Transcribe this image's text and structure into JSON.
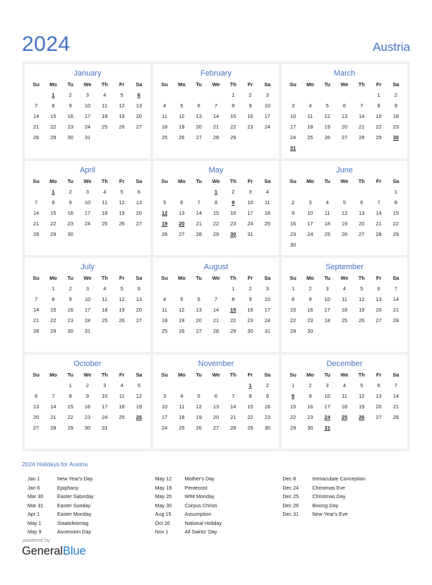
{
  "header": {
    "year": "2024",
    "country": "Austria",
    "accent_color": "#4472C4",
    "holiday_color": "#E00000"
  },
  "weekday_headers": [
    "Su",
    "Mo",
    "Tu",
    "We",
    "Th",
    "Fr",
    "Sa"
  ],
  "months": [
    {
      "name": "January",
      "weeks": [
        [
          "",
          "1",
          "2",
          "3",
          "4",
          "5",
          "6"
        ],
        [
          "7",
          "8",
          "9",
          "10",
          "11",
          "12",
          "13"
        ],
        [
          "14",
          "15",
          "16",
          "17",
          "18",
          "19",
          "20"
        ],
        [
          "21",
          "22",
          "23",
          "24",
          "25",
          "26",
          "27"
        ],
        [
          "28",
          "29",
          "30",
          "31",
          "",
          "",
          ""
        ],
        [
          "",
          "",
          "",
          "",
          "",
          "",
          ""
        ]
      ],
      "holidays": [
        "1",
        "6"
      ]
    },
    {
      "name": "February",
      "weeks": [
        [
          "",
          "",
          "",
          "",
          "1",
          "2",
          "3"
        ],
        [
          "4",
          "5",
          "6",
          "7",
          "8",
          "9",
          "10"
        ],
        [
          "11",
          "12",
          "13",
          "14",
          "15",
          "16",
          "17"
        ],
        [
          "18",
          "19",
          "20",
          "21",
          "22",
          "23",
          "24"
        ],
        [
          "25",
          "26",
          "27",
          "28",
          "29",
          "",
          ""
        ],
        [
          "",
          "",
          "",
          "",
          "",
          "",
          ""
        ]
      ],
      "holidays": []
    },
    {
      "name": "March",
      "weeks": [
        [
          "",
          "",
          "",
          "",
          "",
          "1",
          "2"
        ],
        [
          "3",
          "4",
          "5",
          "6",
          "7",
          "8",
          "9"
        ],
        [
          "10",
          "11",
          "12",
          "13",
          "14",
          "15",
          "16"
        ],
        [
          "17",
          "18",
          "19",
          "20",
          "21",
          "22",
          "23"
        ],
        [
          "24",
          "25",
          "26",
          "27",
          "28",
          "29",
          "30"
        ],
        [
          "31",
          "",
          "",
          "",
          "",
          "",
          ""
        ]
      ],
      "holidays": [
        "30",
        "31"
      ]
    },
    {
      "name": "April",
      "weeks": [
        [
          "",
          "1",
          "2",
          "3",
          "4",
          "5",
          "6"
        ],
        [
          "7",
          "8",
          "9",
          "10",
          "11",
          "12",
          "13"
        ],
        [
          "14",
          "15",
          "16",
          "17",
          "18",
          "19",
          "20"
        ],
        [
          "21",
          "22",
          "23",
          "24",
          "25",
          "26",
          "27"
        ],
        [
          "28",
          "29",
          "30",
          "",
          "",
          "",
          ""
        ],
        [
          "",
          "",
          "",
          "",
          "",
          "",
          ""
        ]
      ],
      "holidays": [
        "1"
      ]
    },
    {
      "name": "May",
      "weeks": [
        [
          "",
          "",
          "",
          "1",
          "2",
          "3",
          "4"
        ],
        [
          "5",
          "6",
          "7",
          "8",
          "9",
          "10",
          "11"
        ],
        [
          "12",
          "13",
          "14",
          "15",
          "16",
          "17",
          "18"
        ],
        [
          "19",
          "20",
          "21",
          "22",
          "23",
          "24",
          "25"
        ],
        [
          "26",
          "27",
          "28",
          "29",
          "30",
          "31",
          ""
        ],
        [
          "",
          "",
          "",
          "",
          "",
          "",
          ""
        ]
      ],
      "holidays": [
        "1",
        "9",
        "12",
        "19",
        "20",
        "30"
      ]
    },
    {
      "name": "June",
      "weeks": [
        [
          "",
          "",
          "",
          "",
          "",
          "",
          "1"
        ],
        [
          "2",
          "3",
          "4",
          "5",
          "6",
          "7",
          "8"
        ],
        [
          "9",
          "10",
          "11",
          "12",
          "13",
          "14",
          "15"
        ],
        [
          "16",
          "17",
          "18",
          "19",
          "20",
          "21",
          "22"
        ],
        [
          "23",
          "24",
          "25",
          "26",
          "27",
          "28",
          "29"
        ],
        [
          "30",
          "",
          "",
          "",
          "",
          "",
          ""
        ]
      ],
      "holidays": []
    },
    {
      "name": "July",
      "weeks": [
        [
          "",
          "1",
          "2",
          "3",
          "4",
          "5",
          "6"
        ],
        [
          "7",
          "8",
          "9",
          "10",
          "11",
          "12",
          "13"
        ],
        [
          "14",
          "15",
          "16",
          "17",
          "18",
          "19",
          "20"
        ],
        [
          "21",
          "22",
          "23",
          "24",
          "25",
          "26",
          "27"
        ],
        [
          "28",
          "29",
          "30",
          "31",
          "",
          "",
          ""
        ],
        [
          "",
          "",
          "",
          "",
          "",
          "",
          ""
        ]
      ],
      "holidays": []
    },
    {
      "name": "August",
      "weeks": [
        [
          "",
          "",
          "",
          "",
          "1",
          "2",
          "3"
        ],
        [
          "4",
          "5",
          "6",
          "7",
          "8",
          "9",
          "10"
        ],
        [
          "11",
          "12",
          "13",
          "14",
          "15",
          "16",
          "17"
        ],
        [
          "18",
          "19",
          "20",
          "21",
          "22",
          "23",
          "24"
        ],
        [
          "25",
          "26",
          "27",
          "28",
          "29",
          "30",
          "31"
        ],
        [
          "",
          "",
          "",
          "",
          "",
          "",
          ""
        ]
      ],
      "holidays": [
        "15"
      ]
    },
    {
      "name": "September",
      "weeks": [
        [
          "1",
          "2",
          "3",
          "4",
          "5",
          "6",
          "7"
        ],
        [
          "8",
          "9",
          "10",
          "11",
          "12",
          "13",
          "14"
        ],
        [
          "15",
          "16",
          "17",
          "18",
          "19",
          "20",
          "21"
        ],
        [
          "22",
          "23",
          "24",
          "25",
          "26",
          "27",
          "28"
        ],
        [
          "29",
          "30",
          "",
          "",
          "",
          "",
          ""
        ],
        [
          "",
          "",
          "",
          "",
          "",
          "",
          ""
        ]
      ],
      "holidays": []
    },
    {
      "name": "October",
      "weeks": [
        [
          "",
          "",
          "1",
          "2",
          "3",
          "4",
          "5"
        ],
        [
          "6",
          "7",
          "8",
          "9",
          "10",
          "11",
          "12"
        ],
        [
          "13",
          "14",
          "15",
          "16",
          "17",
          "18",
          "19"
        ],
        [
          "20",
          "21",
          "22",
          "23",
          "24",
          "25",
          "26"
        ],
        [
          "27",
          "28",
          "29",
          "30",
          "31",
          "",
          ""
        ],
        [
          "",
          "",
          "",
          "",
          "",
          "",
          ""
        ]
      ],
      "holidays": [
        "26"
      ]
    },
    {
      "name": "November",
      "weeks": [
        [
          "",
          "",
          "",
          "",
          "",
          "1",
          "2"
        ],
        [
          "3",
          "4",
          "5",
          "6",
          "7",
          "8",
          "9"
        ],
        [
          "10",
          "11",
          "12",
          "13",
          "14",
          "15",
          "16"
        ],
        [
          "17",
          "18",
          "19",
          "20",
          "21",
          "22",
          "23"
        ],
        [
          "24",
          "25",
          "26",
          "27",
          "28",
          "29",
          "30"
        ],
        [
          "",
          "",
          "",
          "",
          "",
          "",
          ""
        ]
      ],
      "holidays": [
        "1"
      ]
    },
    {
      "name": "December",
      "weeks": [
        [
          "1",
          "2",
          "3",
          "4",
          "5",
          "6",
          "7"
        ],
        [
          "8",
          "9",
          "10",
          "11",
          "12",
          "13",
          "14"
        ],
        [
          "15",
          "16",
          "17",
          "18",
          "19",
          "20",
          "21"
        ],
        [
          "22",
          "23",
          "24",
          "25",
          "26",
          "27",
          "28"
        ],
        [
          "29",
          "30",
          "31",
          "",
          "",
          "",
          ""
        ],
        [
          "",
          "",
          "",
          "",
          "",
          "",
          ""
        ]
      ],
      "holidays": [
        "8",
        "24",
        "25",
        "26",
        "31"
      ]
    }
  ],
  "legend": {
    "title": "2024 Holidays for Austria",
    "columns": [
      [
        {
          "date": "Jan 1",
          "name": "New Year's Day"
        },
        {
          "date": "Jan 6",
          "name": "Epiphany"
        },
        {
          "date": "Mar 30",
          "name": "Easter Saturday"
        },
        {
          "date": "Mar 31",
          "name": "Easter Sunday"
        },
        {
          "date": "Apr 1",
          "name": "Easter Monday"
        },
        {
          "date": "May 1",
          "name": "Staatsfeiertag"
        },
        {
          "date": "May 9",
          "name": "Ascension Day"
        }
      ],
      [
        {
          "date": "May 12",
          "name": "Mother's Day"
        },
        {
          "date": "May 19",
          "name": "Pentecost"
        },
        {
          "date": "May 20",
          "name": "Whit Monday"
        },
        {
          "date": "May 30",
          "name": "Corpus Christi"
        },
        {
          "date": "Aug 15",
          "name": "Assumption"
        },
        {
          "date": "Oct 26",
          "name": "National Holiday"
        },
        {
          "date": "Nov 1",
          "name": "All Saints' Day"
        }
      ],
      [
        {
          "date": "Dec 8",
          "name": "Immaculate Conception"
        },
        {
          "date": "Dec 24",
          "name": "Christmas Eve"
        },
        {
          "date": "Dec 25",
          "name": "Christmas Day"
        },
        {
          "date": "Dec 26",
          "name": "Boxing Day"
        },
        {
          "date": "Dec 31",
          "name": "New Year's Eve"
        }
      ]
    ]
  },
  "footer": {
    "powered_by": "powered by",
    "brand_first": "General",
    "brand_second": "Blue"
  }
}
